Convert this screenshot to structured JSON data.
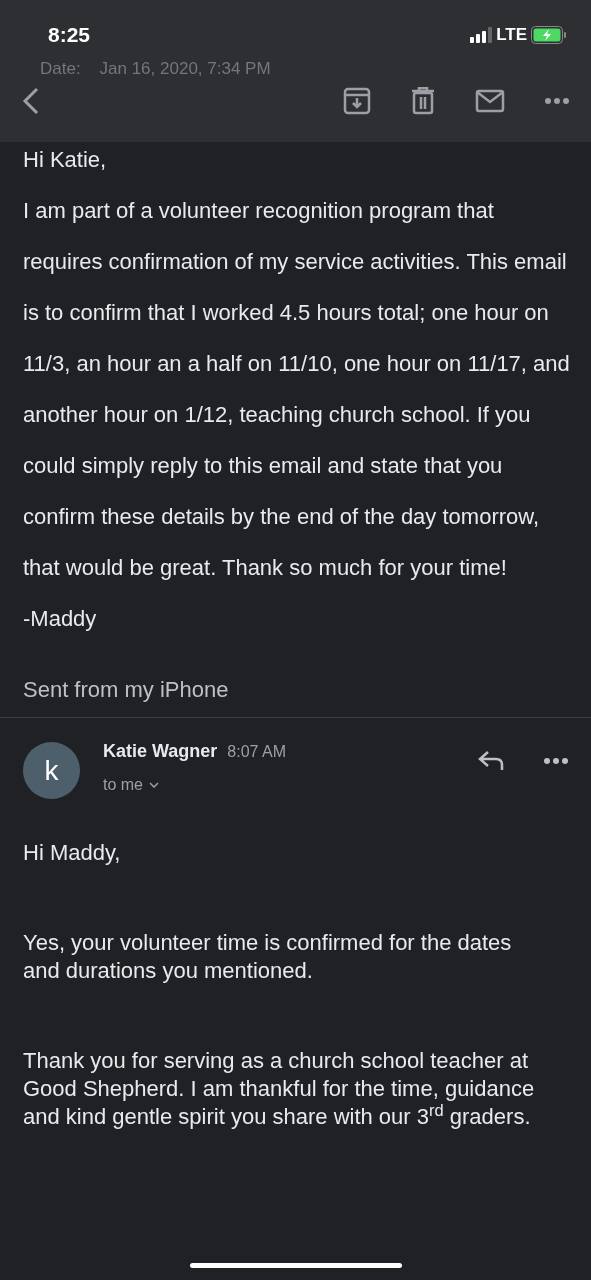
{
  "status_bar": {
    "time": "8:25",
    "network": "LTE"
  },
  "quoted_header": {
    "date": "Date:    Jan 16, 2020, 7:34 PM"
  },
  "original_message": {
    "greeting": "Hi Katie,",
    "body": "I am part of a volunteer recognition program that requires confirmation of my service activities. This email is to confirm that I worked 4.5 hours total; one hour on 11/3, an hour an a half on 11/10, one hour on 11/17, and another hour on 1/12, teaching church school. If you could simply reply to this email and state that you confirm these details by the end of the day tomorrow, that would be great. Thank so much for your time!",
    "signature": "-Maddy",
    "footer": "Sent from my iPhone"
  },
  "reply": {
    "avatar_letter": "k",
    "sender": "Katie Wagner",
    "time": "8:07 AM",
    "recipient": "to me",
    "paragraphs": [
      "Hi Maddy,",
      "Yes, your volunteer time is confirmed for the dates and durations you mentioned.",
      "Thank you for serving as a church school teacher at Good Shepherd. I am thankful for the time, guidance and kind gentle spirit you share with our 3$^{rd}$ graders."
    ]
  }
}
